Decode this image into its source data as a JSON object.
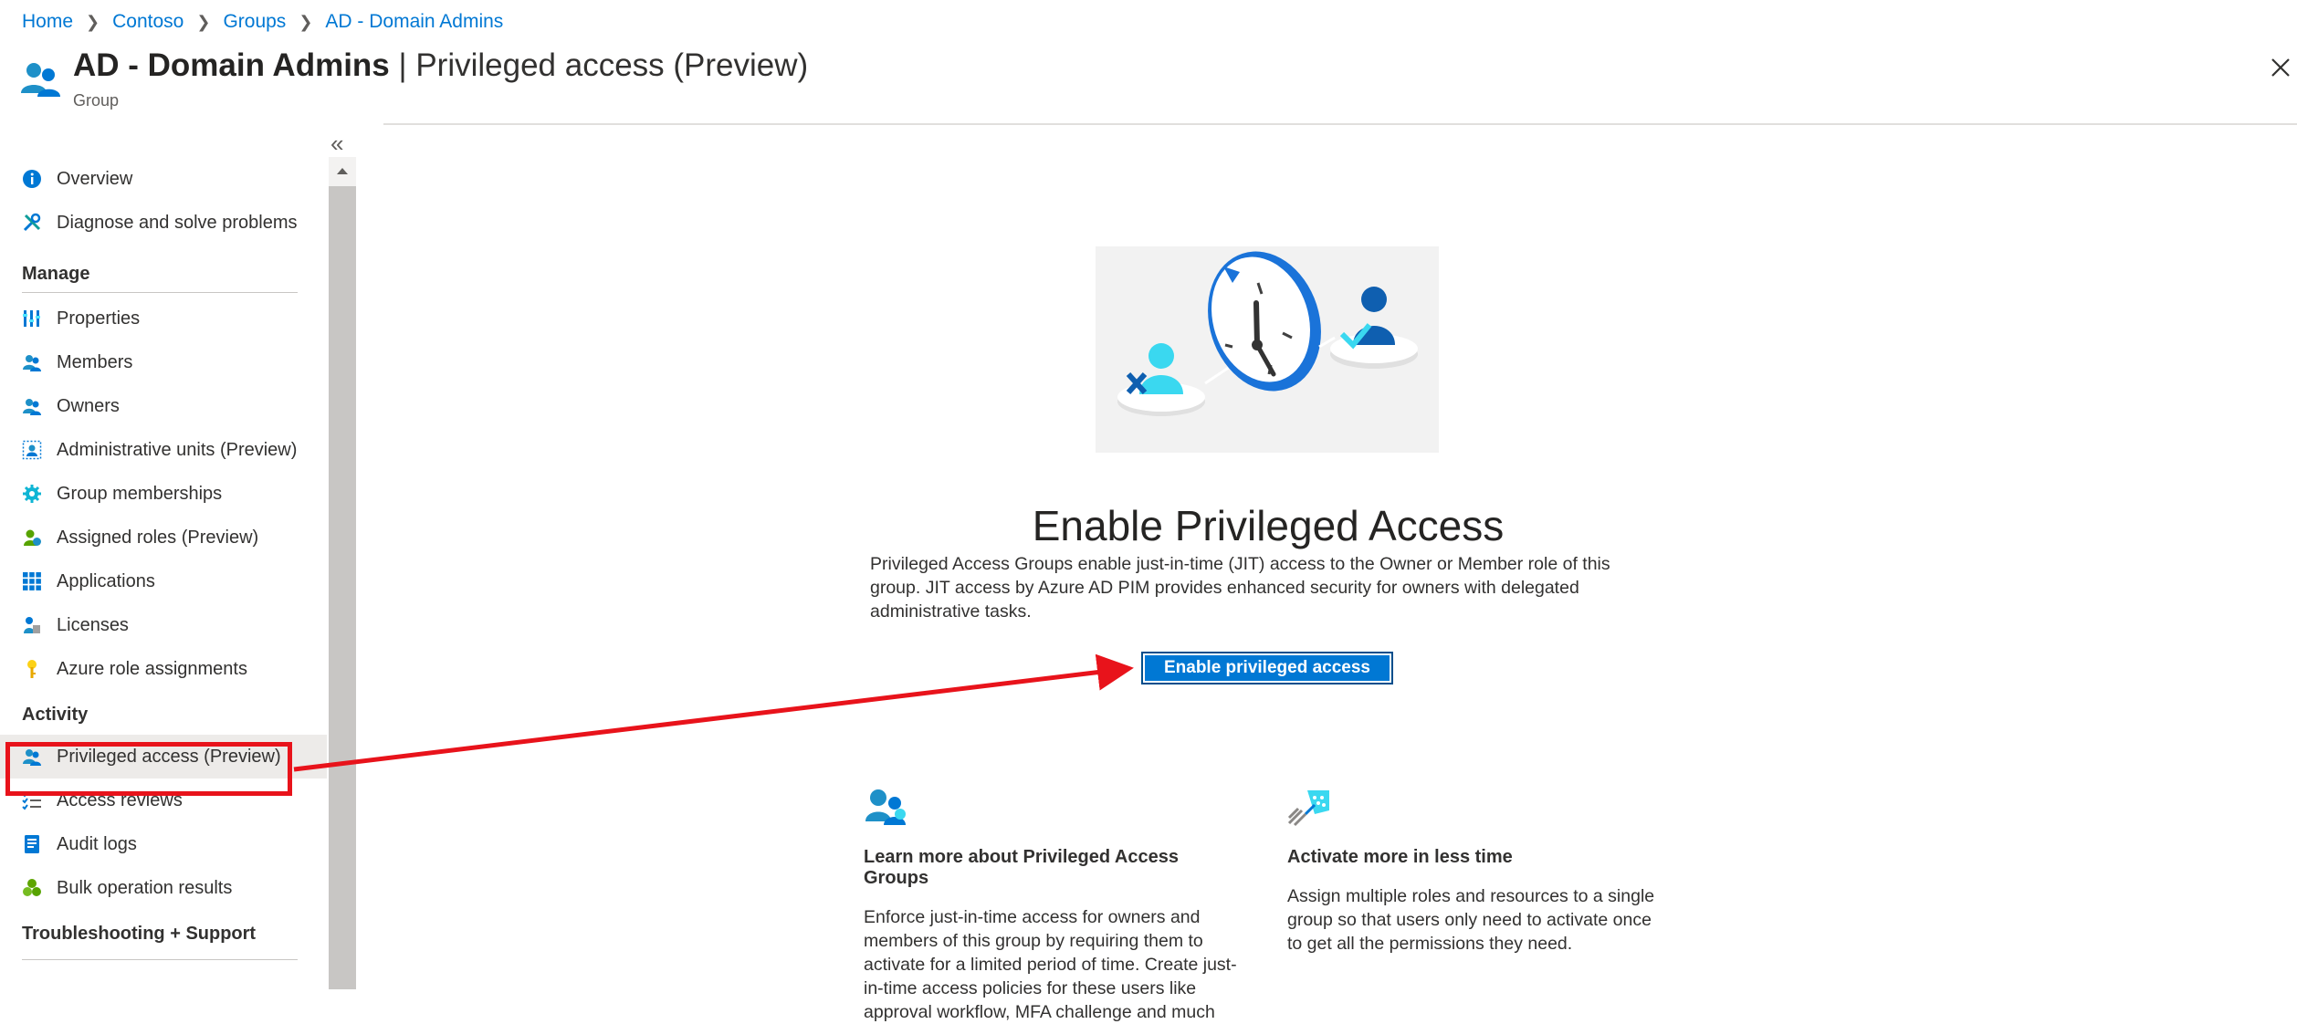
{
  "breadcrumb": {
    "items": [
      "Home",
      "Contoso",
      "Groups",
      "AD - Domain Admins"
    ]
  },
  "header": {
    "title_bold": "AD - Domain Admins",
    "title_rest": " | Privileged access (Preview)",
    "subtitle": "Group"
  },
  "sidebar": {
    "items_top": [
      {
        "label": "Overview",
        "icon": "info-icon"
      },
      {
        "label": "Diagnose and solve problems",
        "icon": "wrench-icon"
      }
    ],
    "manage_heading": "Manage",
    "manage_items": [
      {
        "label": "Properties",
        "icon": "properties-icon"
      },
      {
        "label": "Members",
        "icon": "members-icon"
      },
      {
        "label": "Owners",
        "icon": "owners-icon"
      },
      {
        "label": "Administrative units (Preview)",
        "icon": "admin-units-icon"
      },
      {
        "label": "Group memberships",
        "icon": "gear-icon"
      },
      {
        "label": "Assigned roles (Preview)",
        "icon": "assigned-roles-icon"
      },
      {
        "label": "Applications",
        "icon": "applications-icon"
      },
      {
        "label": "Licenses",
        "icon": "licenses-icon"
      },
      {
        "label": "Azure role assignments",
        "icon": "key-icon"
      }
    ],
    "activity_heading": "Activity",
    "activity_items": [
      {
        "label": "Privileged access (Preview)",
        "icon": "privileged-access-icon",
        "selected": true
      },
      {
        "label": "Access reviews",
        "icon": "checklist-icon"
      },
      {
        "label": "Audit logs",
        "icon": "audit-log-icon"
      },
      {
        "label": "Bulk operation results",
        "icon": "bulk-results-icon"
      }
    ],
    "troubleshooting_heading": "Troubleshooting + Support"
  },
  "main": {
    "heading": "Enable Privileged Access",
    "description": "Privileged Access Groups enable just-in-time (JIT) access to the Owner or Member role of this group. JIT access by Azure AD PIM provides enhanced security for owners with delegated administrative tasks.",
    "enable_button_label": "Enable privileged access",
    "cards": [
      {
        "title": "Learn more about Privileged Access Groups",
        "body": "Enforce just-in-time access for owners and members of this group by requiring them to activate for a limited period of time. Create just-in-time access policies for these users like approval workflow, MFA challenge and much",
        "icon": "privileged-groups-icon"
      },
      {
        "title": "Activate more in less time",
        "body": "Assign multiple roles and resources to a single group so that users only need to activate once to get all the permissions they need.",
        "icon": "rocket-icon"
      }
    ]
  },
  "colors": {
    "accent": "#0078d4",
    "annotation": "#e8131b"
  }
}
